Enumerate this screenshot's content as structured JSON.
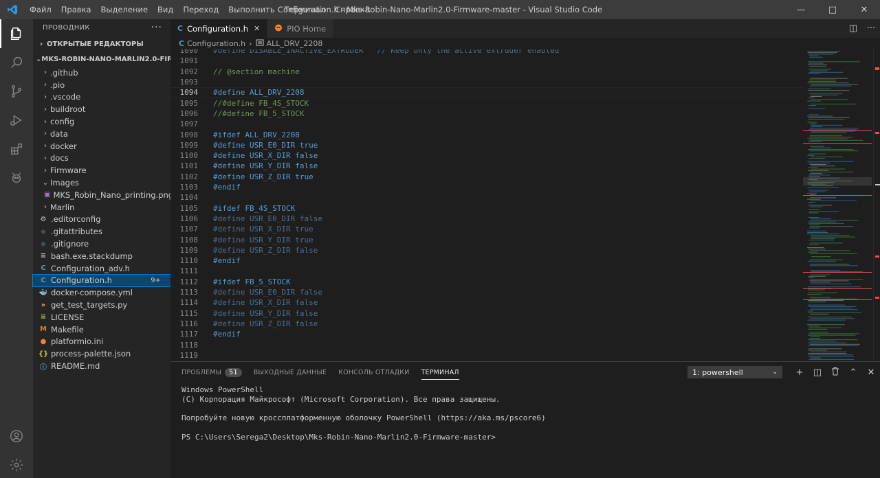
{
  "titlebar": {
    "menu": [
      "Файл",
      "Правка",
      "Выделение",
      "Вид",
      "Переход",
      "Выполнить",
      "Терминал",
      "Справка"
    ],
    "title": "Configuration.h - Mks-Robin-Nano-Marlin2.0-Firmware-master - Visual Studio Code"
  },
  "sidebar": {
    "header": "ПРОВОДНИК",
    "open_editors": "ОТКРЫТЫЕ РЕДАКТОРЫ",
    "project": "MKS-ROBIN-NANO-MARLIN2.0-FIRMWARE-...",
    "items": [
      {
        "label": ".github",
        "type": "folder"
      },
      {
        "label": ".pio",
        "type": "folder"
      },
      {
        "label": ".vscode",
        "type": "folder"
      },
      {
        "label": "buildroot",
        "type": "folder"
      },
      {
        "label": "config",
        "type": "folder"
      },
      {
        "label": "data",
        "type": "folder"
      },
      {
        "label": "docker",
        "type": "folder"
      },
      {
        "label": "docs",
        "type": "folder"
      },
      {
        "label": "Firmware",
        "type": "folder"
      },
      {
        "label": "Images",
        "type": "folder-open"
      },
      {
        "label": "MKS_Robin_Nano_printing.png",
        "type": "image"
      },
      {
        "label": "Marlin",
        "type": "folder"
      },
      {
        "label": ".editorconfig",
        "type": "gear"
      },
      {
        "label": ".gitattributes",
        "type": "git"
      },
      {
        "label": ".gitignore",
        "type": "git"
      },
      {
        "label": "bash.exe.stackdump",
        "type": "text"
      },
      {
        "label": "Configuration_adv.h",
        "type": "c"
      },
      {
        "label": "Configuration.h",
        "type": "c",
        "badge": "9+",
        "selected": true
      },
      {
        "label": "docker-compose.yml",
        "type": "docker"
      },
      {
        "label": "get_test_targets.py",
        "type": "python"
      },
      {
        "label": "LICENSE",
        "type": "license"
      },
      {
        "label": "Makefile",
        "type": "make"
      },
      {
        "label": "platformio.ini",
        "type": "pio"
      },
      {
        "label": "process-palette.json",
        "type": "json"
      },
      {
        "label": "README.md",
        "type": "info"
      }
    ]
  },
  "tabs": [
    {
      "label": "Configuration.h",
      "icon": "C",
      "active": true
    },
    {
      "label": "PIO Home",
      "icon": "pio-icon",
      "active": false
    }
  ],
  "breadcrumb": {
    "file": "Configuration.h",
    "symbol": "ALL_DRV_2208"
  },
  "editor": {
    "lines": [
      {
        "n": "1090",
        "text": "#define DISABLE_INACTIVE_EXTRUDER   // Keep only the active extruder enabled",
        "style": "partial"
      },
      {
        "n": "1091",
        "text": "",
        "style": "kw"
      },
      {
        "n": "1092",
        "text": "// @section machine",
        "style": "com"
      },
      {
        "n": "1093",
        "text": "",
        "style": "kw"
      },
      {
        "n": "1094",
        "text": "#define ALL_DRV_2208",
        "style": "kw",
        "current": true
      },
      {
        "n": "1095",
        "text": "//#define FB_4S_STOCK",
        "style": "com"
      },
      {
        "n": "1096",
        "text": "//#define FB_5_STOCK",
        "style": "com"
      },
      {
        "n": "1097",
        "text": "",
        "style": "kw"
      },
      {
        "n": "1098",
        "text": "#ifdef ALL_DRV_2208",
        "style": "kw"
      },
      {
        "n": "1099",
        "text": "#define USR_E0_DIR true",
        "style": "kw"
      },
      {
        "n": "1100",
        "text": "#define USR_X_DIR false",
        "style": "kw"
      },
      {
        "n": "1101",
        "text": "#define USR_Y_DIR false",
        "style": "kw"
      },
      {
        "n": "1102",
        "text": "#define USR_Z_DIR true",
        "style": "kw"
      },
      {
        "n": "1103",
        "text": "#endif",
        "style": "kw"
      },
      {
        "n": "1104",
        "text": "",
        "style": "kw"
      },
      {
        "n": "1105",
        "text": "#ifdef FB_4S_STOCK",
        "style": "kw"
      },
      {
        "n": "1106",
        "text": "#define USR_E0_DIR false",
        "style": "dim"
      },
      {
        "n": "1107",
        "text": "#define USR_X_DIR true",
        "style": "dim"
      },
      {
        "n": "1108",
        "text": "#define USR_Y_DIR true",
        "style": "dim"
      },
      {
        "n": "1109",
        "text": "#define USR_Z_DIR false",
        "style": "dim"
      },
      {
        "n": "1110",
        "text": "#endif",
        "style": "kw"
      },
      {
        "n": "1111",
        "text": "",
        "style": "kw"
      },
      {
        "n": "1112",
        "text": "#ifdef FB_5_STOCK",
        "style": "kw"
      },
      {
        "n": "1113",
        "text": "#define USR_E0_DIR false",
        "style": "dim"
      },
      {
        "n": "1114",
        "text": "#define USR_X_DIR false",
        "style": "dim"
      },
      {
        "n": "1115",
        "text": "#define USR_Y_DIR false",
        "style": "dim"
      },
      {
        "n": "1116",
        "text": "#define USR_Z_DIR false",
        "style": "dim"
      },
      {
        "n": "1117",
        "text": "#endif",
        "style": "kw"
      },
      {
        "n": "1118",
        "text": "",
        "style": "kw"
      },
      {
        "n": "1119",
        "text": "",
        "style": "kw"
      }
    ]
  },
  "panel": {
    "tabs": [
      {
        "label": "ПРОБЛЕМЫ",
        "count": "51"
      },
      {
        "label": "ВЫХОДНЫЕ ДАННЫЕ"
      },
      {
        "label": "КОНСОЛЬ ОТЛАДКИ"
      },
      {
        "label": "ТЕРМИНАЛ",
        "active": true
      }
    ],
    "terminal_select": "1: powershell",
    "terminal_lines": [
      "Windows PowerShell",
      "(C) Корпорация Майкрософт (Microsoft Corporation). Все права защищены.",
      "",
      "Попробуйте новую кроссплатформенную оболочку PowerShell (https://aka.ms/pscore6)",
      "",
      "PS C:\\Users\\Serega2\\Desktop\\Mks-Robin-Nano-Marlin2.0-Firmware-master>"
    ]
  },
  "colors": {
    "accent": "#007acc",
    "keyword": "#569cd6",
    "comment": "#6a9955",
    "selection": "#094771"
  }
}
